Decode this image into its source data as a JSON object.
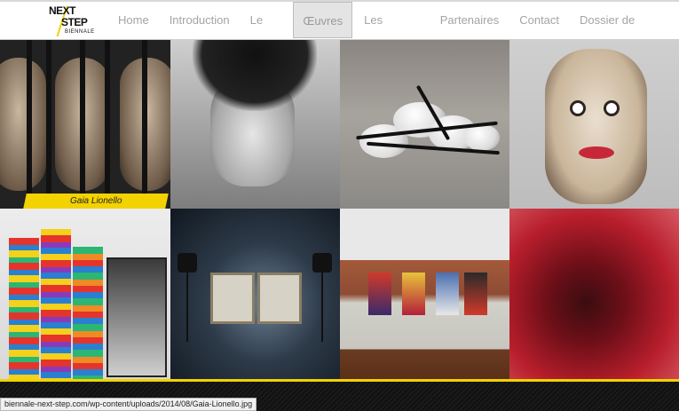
{
  "logo": {
    "line1": "NEXT",
    "line2": "STEP",
    "line3": "BIENNALE"
  },
  "nav": {
    "items": [
      {
        "label": "Home"
      },
      {
        "label": "Introduction"
      },
      {
        "label": "Le lieu"
      },
      {
        "label": "Œuvres",
        "active": true
      },
      {
        "label": "Les Artistes"
      },
      {
        "label": "Partenaires"
      },
      {
        "label": "Contact"
      },
      {
        "label": "Dossier de Presse"
      }
    ]
  },
  "gallery": {
    "hover_caption": "Gaia Lionello"
  },
  "status_bar": {
    "url": "biennale-next-step.com/wp-content/uploads/2014/08/Gaia-Lionello.jpg"
  },
  "colors": {
    "accent": "#f2d200",
    "nav_text": "#a4a4a4",
    "active_tab_bg": "#e4e4e4"
  }
}
